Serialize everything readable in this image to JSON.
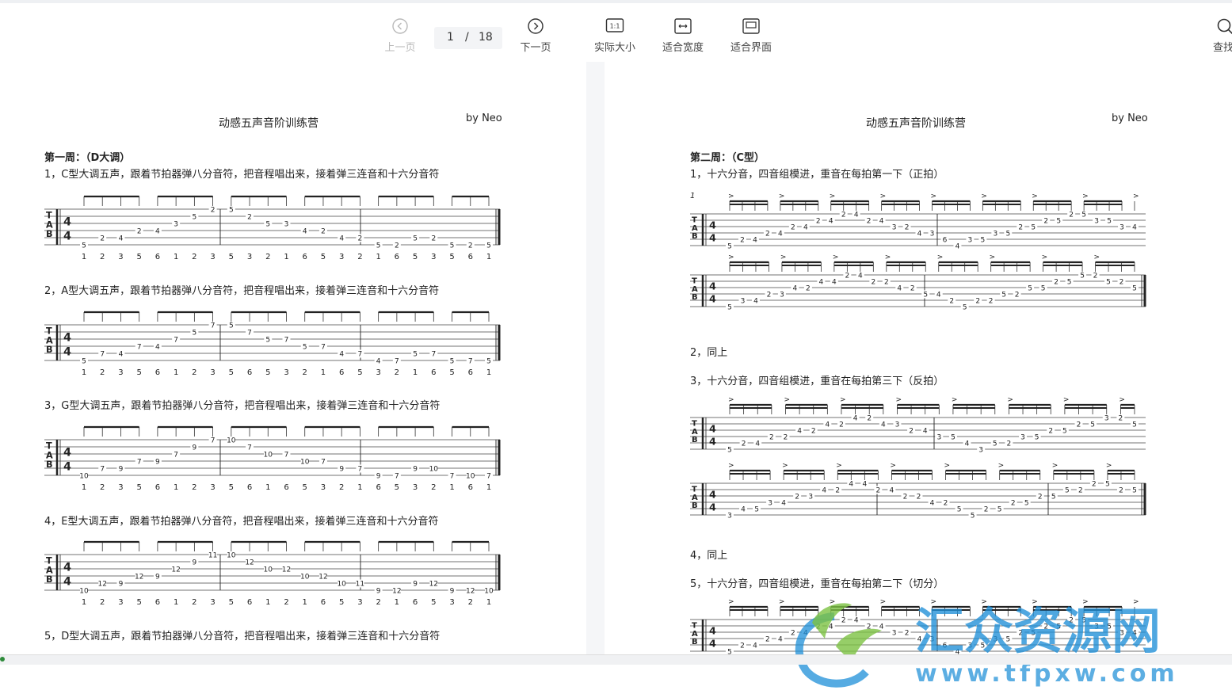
{
  "toolbar": {
    "prev_label": "上一页",
    "next_label": "下一页",
    "current_page": "1",
    "separator": "/",
    "total_pages": "18",
    "actual_size_label": "实际大小",
    "actual_size_icon_text": "1:1",
    "fit_width_label": "适合宽度",
    "fit_page_label": "适合界面",
    "search_label": "查找"
  },
  "left_page": {
    "title": "动感五声音阶训练营",
    "author": "by Neo",
    "week_heading": "第一周：（D大调）",
    "exercises": [
      {
        "text": "1，C型大调五声，跟着节拍器弹八分音符，把音程唱出来，接着弹三连音和十六分音符",
        "degrees": [
          "1",
          "2",
          "3",
          "5",
          "6",
          "1",
          "2",
          "3",
          "5",
          "3",
          "2",
          "1",
          "6",
          "5",
          "3",
          "2",
          "1",
          "6",
          "5",
          "3",
          "5",
          "6",
          "1"
        ]
      },
      {
        "text": "2，A型大调五声，跟着节拍器弹八分音符，把音程唱出来，接着弹三连音和十六分音符",
        "degrees": [
          "1",
          "2",
          "3",
          "5",
          "6",
          "1",
          "2",
          "3",
          "5",
          "6",
          "5",
          "3",
          "2",
          "1",
          "6",
          "5",
          "3",
          "2",
          "1",
          "6",
          "5",
          "6",
          "1"
        ]
      },
      {
        "text": "3，G型大调五声，跟着节拍器弹八分音符，把音程唱出来，接着弹三连音和十六分音符",
        "degrees": [
          "1",
          "2",
          "3",
          "5",
          "6",
          "1",
          "2",
          "3",
          "5",
          "6",
          "1",
          "6",
          "5",
          "3",
          "2",
          "1",
          "6",
          "5",
          "3",
          "2",
          "1",
          "6",
          "1"
        ]
      },
      {
        "text": "4，E型大调五声，跟着节拍器弹八分音符，把音程唱出来，接着弹三连音和十六分音符",
        "degrees": [
          "1",
          "2",
          "3",
          "5",
          "6",
          "1",
          "2",
          "3",
          "5",
          "6",
          "1",
          "2",
          "1",
          "6",
          "5",
          "3",
          "2",
          "1",
          "6",
          "5",
          "3",
          "2",
          "1"
        ]
      },
      {
        "text": "5，D型大调五声，跟着节拍器弹八分音符，把音程唱出来，接着弹三连音和十六分音符",
        "degrees": []
      }
    ],
    "tab_fret_rows": [
      [
        "5",
        "2",
        "4",
        "2",
        "4",
        "3",
        "5",
        "2",
        "5",
        "2",
        "5",
        "3",
        "4",
        "2",
        "4",
        "2",
        "5",
        "2",
        "5",
        "2",
        "5",
        "2",
        "5"
      ],
      [
        "5",
        "7",
        "4",
        "7",
        "4",
        "7",
        "5",
        "7",
        "5",
        "7",
        "5",
        "7",
        "5",
        "7",
        "4",
        "7",
        "4",
        "7",
        "5",
        "7",
        "5",
        "7",
        "5"
      ],
      [
        "10",
        "7",
        "9",
        "7",
        "9",
        "7",
        "9",
        "7",
        "10",
        "7",
        "10",
        "7",
        "10",
        "7",
        "9",
        "7",
        "9",
        "7",
        "9",
        "10",
        "7",
        "10",
        "7"
      ],
      [
        "10",
        "12",
        "9",
        "12",
        "9",
        "12",
        "9",
        "11",
        "10",
        "12",
        "10",
        "12",
        "10",
        "12",
        "10",
        "11",
        "9",
        "12",
        "9",
        "12",
        "9",
        "12",
        "10"
      ]
    ]
  },
  "right_page": {
    "title": "动感五声音阶训练营",
    "author": "by Neo",
    "week_heading": "第二周：（C型）",
    "items": [
      "1，十六分音，四音组模进，重音在每拍第一下（正拍）",
      "2，同上",
      "3，十六分音，四音组模进，重音在每拍第三下（反拍）",
      "4，同上",
      "5，十六分音，四音组模进，重音在每拍第二下（切分）"
    ],
    "measure_number": "1",
    "tab_fret_rows": [
      [
        "5",
        "2",
        "4",
        "2",
        "4",
        "2",
        "4",
        "2",
        "4",
        "2",
        "4",
        "2",
        "4",
        "3",
        "2",
        "4",
        "3",
        "6",
        "4",
        "3",
        "5",
        "3",
        "5",
        "2",
        "5",
        "2",
        "5",
        "2",
        "5",
        "3",
        "5",
        "3",
        "4"
      ],
      [
        "5",
        "3",
        "4",
        "2",
        "3",
        "4",
        "2",
        "4",
        "4",
        "2",
        "4",
        "2",
        "2",
        "4",
        "2",
        "5",
        "4",
        "2",
        "5",
        "2",
        "2",
        "5",
        "2",
        "5",
        "5",
        "2",
        "5",
        "5",
        "2",
        "5",
        "2",
        "5"
      ],
      [
        "5",
        "2",
        "4",
        "2",
        "2",
        "4",
        "2",
        "4",
        "2",
        "4",
        "2",
        "4",
        "3",
        "2",
        "4",
        "3",
        "5",
        "4",
        "3",
        "5",
        "2",
        "3",
        "5",
        "2",
        "5",
        "2",
        "5",
        "3",
        "2",
        "5"
      ],
      [
        "3",
        "4",
        "5",
        "3",
        "4",
        "2",
        "3",
        "4",
        "2",
        "4",
        "4",
        "2",
        "4",
        "2",
        "2",
        "4",
        "2",
        "5",
        "5",
        "2",
        "5",
        "2",
        "5",
        "2",
        "5",
        "5",
        "2",
        "2",
        "5",
        "2",
        "5"
      ]
    ]
  },
  "watermark": {
    "brand_text": "汇众资源网",
    "url_text": "www.tfpxw.com"
  },
  "colors": {
    "toolbar_bg": "#ffffff",
    "doc_bg": "#f5f6f8",
    "disabled_text": "#b9b9b9",
    "watermark_blue": "#1e8fd8",
    "watermark_green": "#7cc242"
  }
}
